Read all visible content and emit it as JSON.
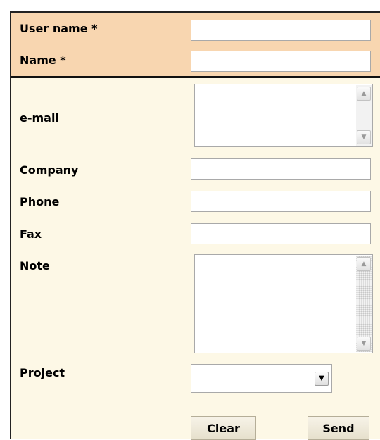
{
  "form": {
    "username_label": "User name *",
    "username_value": "",
    "name_label": "Name *",
    "name_value": "",
    "email_label": "e-mail",
    "email_value": "",
    "company_label": "Company",
    "company_value": "",
    "phone_label": "Phone",
    "phone_value": "",
    "fax_label": "Fax",
    "fax_value": "",
    "note_label": "Note",
    "note_value": "",
    "project_label": "Project",
    "project_selected": "",
    "clear_label": "Clear",
    "send_label": "Send"
  },
  "colors": {
    "required_bg": "#f8d6b0",
    "optional_bg": "#fdf8e6"
  },
  "icons": {
    "scroll_up": "triangle-up-icon",
    "scroll_down": "triangle-down-icon",
    "dropdown": "chevron-down-icon"
  }
}
